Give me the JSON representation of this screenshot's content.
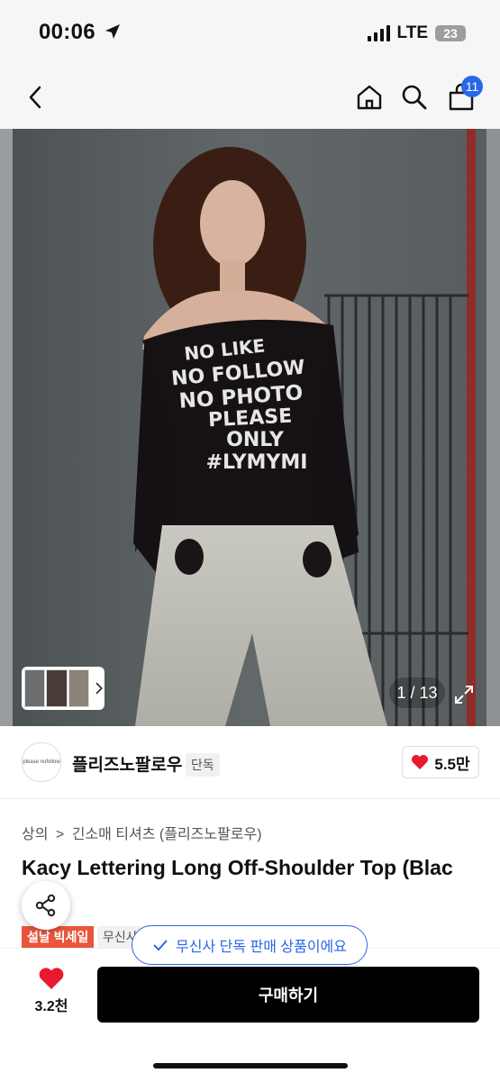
{
  "status": {
    "time": "00:06",
    "network": "LTE",
    "battery": "23"
  },
  "nav": {
    "cart_count": "11"
  },
  "gallery": {
    "counter": "1 / 13",
    "shirt_lines": [
      "NO LIKE",
      "NO FOLLOW",
      "NO PHOTO",
      "PLEASE",
      "ONLY",
      "#LYMYMI"
    ]
  },
  "brand": {
    "logo_text": "please nofollow",
    "name": "플리즈노팔로우",
    "tag": "단독",
    "likes": "5.5만"
  },
  "breadcrumb": {
    "cat1": "상의",
    "sep": ">",
    "cat2": "긴소매 티셔츠 (플리즈노팔로우)"
  },
  "product": {
    "title": "Kacy Lettering Long Off-Shoulder Top (Blac"
  },
  "badges": {
    "sale": "설날 빅세일",
    "second": "무신사"
  },
  "toast": {
    "text": "무신사 단독 판매 상품이에요"
  },
  "bottom": {
    "wish_count": "3.2천",
    "buy_label": "구매하기"
  },
  "colors": {
    "accent_blue": "#2a66e8",
    "sale_red": "#e9553d",
    "heart_red": "#e8192c"
  }
}
